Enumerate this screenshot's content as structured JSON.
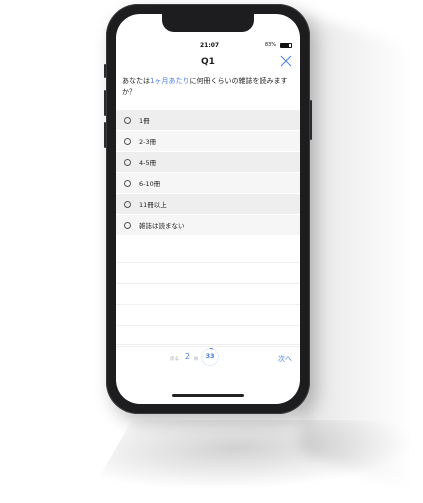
{
  "status": {
    "time": "21:07",
    "battery": "83%"
  },
  "header": {
    "title": "Q1"
  },
  "question": {
    "before": "あなたは",
    "highlight": "1ヶ月あたり",
    "after": "に何冊くらいの雑誌を読みますか？"
  },
  "options": [
    {
      "label": "1冊"
    },
    {
      "label": "2-3冊"
    },
    {
      "label": "4-5冊"
    },
    {
      "label": "6-10冊"
    },
    {
      "label": "11冊以上"
    },
    {
      "label": "雑誌は読まない"
    }
  ],
  "footer": {
    "prev_label": "戻る",
    "current": "2",
    "current_suffix": "問",
    "total": "33",
    "next_label": "次へ"
  },
  "colors": {
    "accent": "#4a7ee0",
    "frame": "#1d1d1f"
  }
}
